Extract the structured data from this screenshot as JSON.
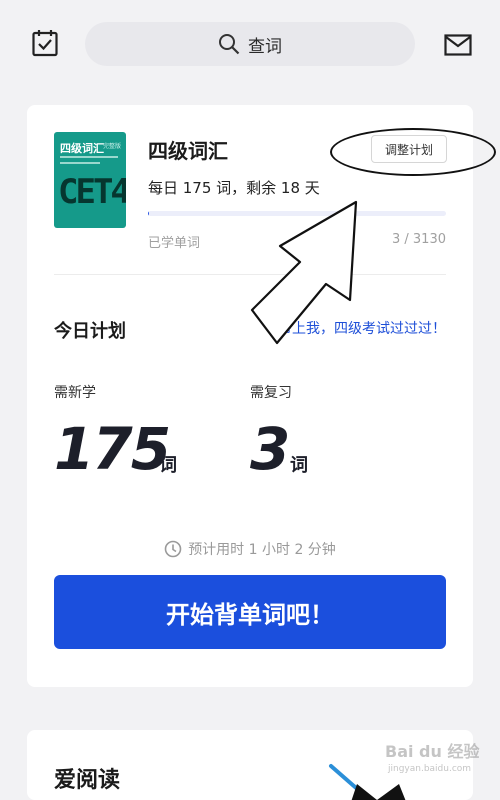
{
  "header": {
    "search_label": "查词"
  },
  "book": {
    "cover_title": "四级词汇",
    "cover_tag": "完整版",
    "cover_big": "CET4",
    "title": "四级词汇",
    "adjust_button": "调整计划",
    "daily_text": "每日 175 词，剩余 18 天",
    "progress_fraction": 0.001,
    "learned_label": "已学单词",
    "learned_count": "3 / 3130"
  },
  "plan": {
    "title": "今日计划",
    "slogan": "带上我，四级考试过过过！",
    "new_label": "需新学",
    "new_count": "175",
    "new_unit": "词",
    "review_label": "需复习",
    "review_count": "3",
    "review_unit": "词",
    "estimate": "预计用时 1 小时 2 分钟",
    "start_button": "开始背单词吧！"
  },
  "reading": {
    "title": "爱阅读"
  },
  "watermark": {
    "main": "Bai du 经验",
    "sub": "jingyan.baidu.com"
  },
  "colors": {
    "accent": "#1b4fdd",
    "cover": "#159a8a"
  }
}
